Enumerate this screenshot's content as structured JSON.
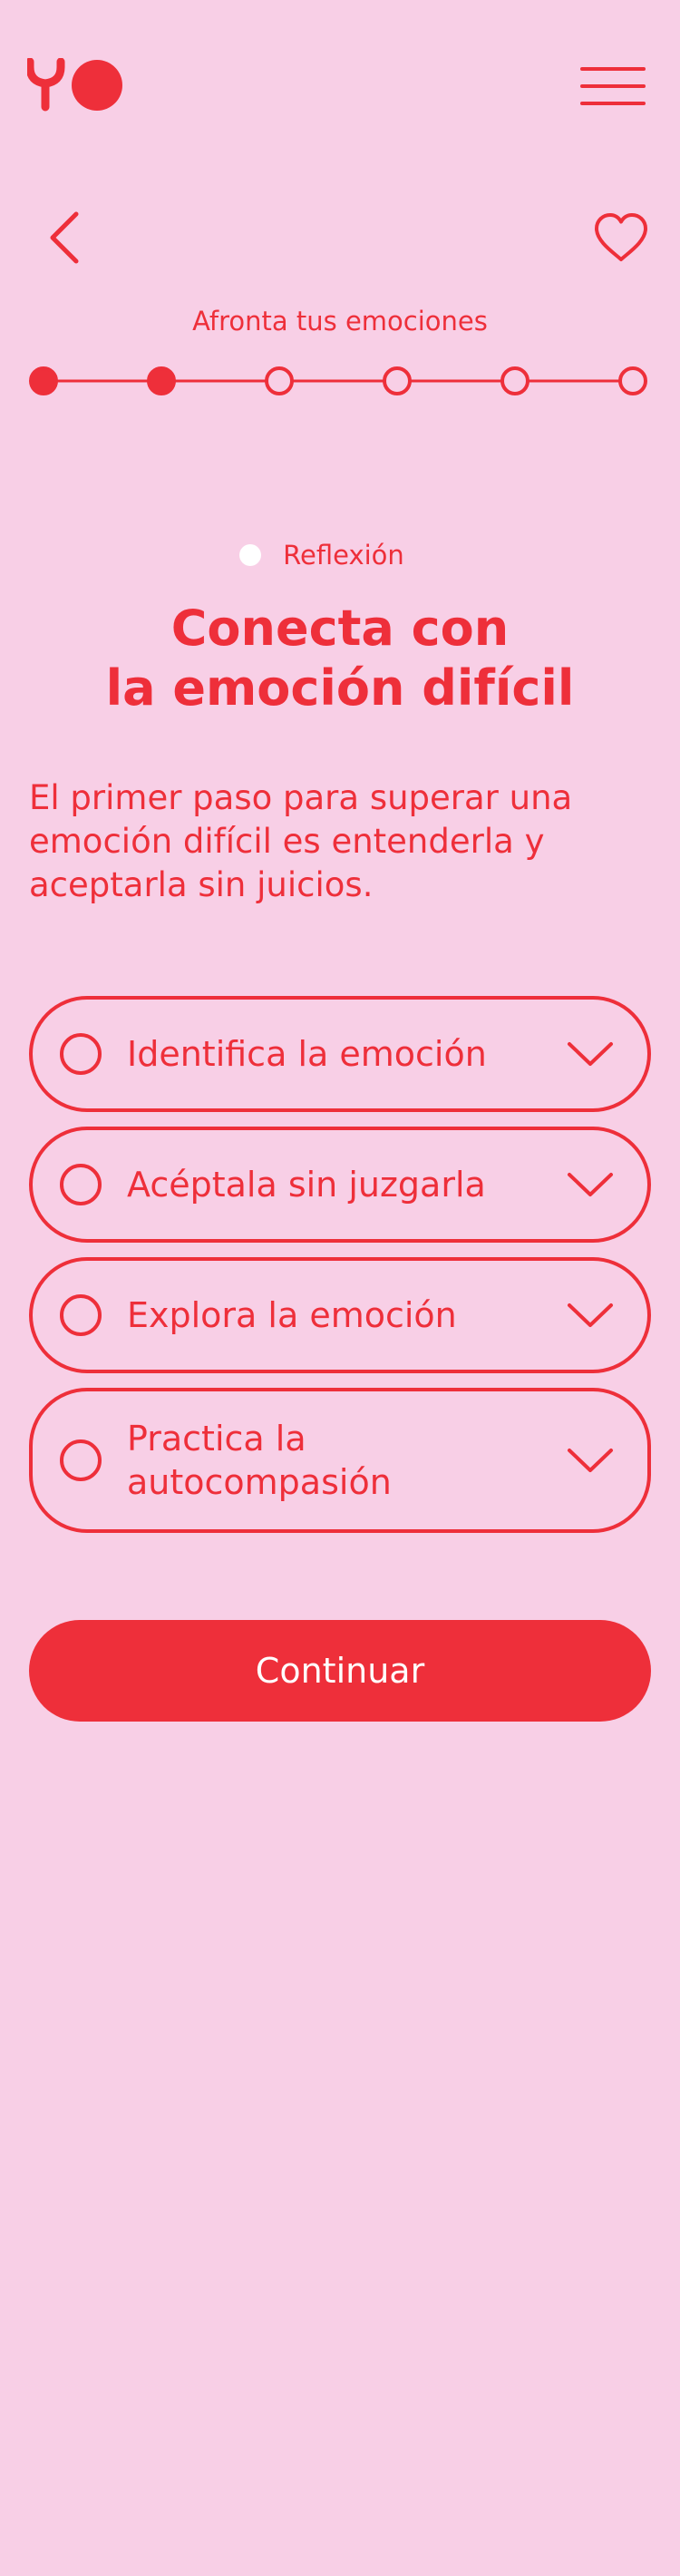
{
  "header": {
    "logo_icon": "yo-logo",
    "menu_icon": "hamburger-menu-icon"
  },
  "nav": {
    "back_icon": "chevron-left-icon",
    "favorite_icon": "heart-outline-icon",
    "module_title": "Afronta tus emociones"
  },
  "stepper": {
    "total_steps": 6,
    "completed_steps": 2
  },
  "content": {
    "tag_label": "Reflexión",
    "title_line1": "Conecta con",
    "title_line2": "la emoción difícil",
    "intro": "El primer paso para superar una emoción difícil es entenderla y aceptarla sin juicios."
  },
  "accordion": {
    "items": [
      {
        "label": "Identifica la emoción"
      },
      {
        "label": "Acéptala sin juzgarla"
      },
      {
        "label": "Explora la emoción"
      },
      {
        "label": "Practica la autocompasión"
      }
    ]
  },
  "cta": {
    "label": "Continuar"
  },
  "colors": {
    "background": "#f8cfe6",
    "accent": "#ee2f3a",
    "tag_dot": "#ffffff"
  }
}
